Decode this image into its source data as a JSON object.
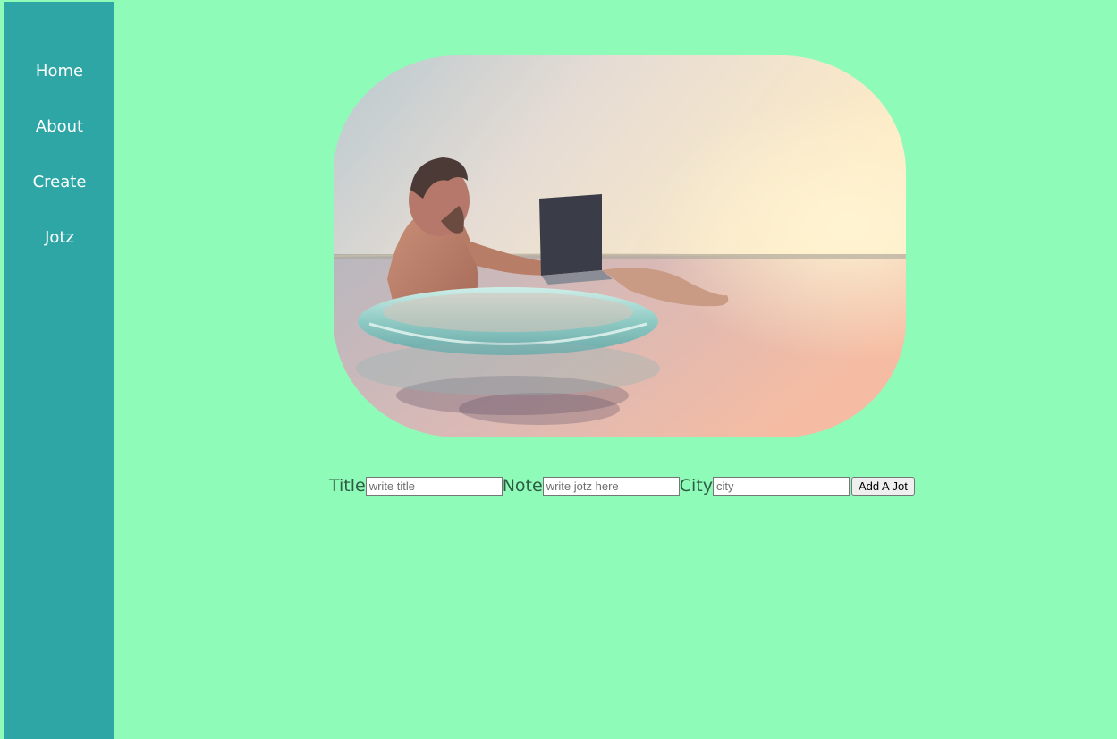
{
  "nav": {
    "items": [
      {
        "label": "Home"
      },
      {
        "label": "About"
      },
      {
        "label": "Create"
      },
      {
        "label": "Jotz"
      }
    ]
  },
  "form": {
    "title_label": "Title",
    "title_placeholder": "write title",
    "note_label": "Note",
    "note_placeholder": "write jotz here",
    "city_label": "City",
    "city_placeholder": "city",
    "submit_label": "Add A Jot"
  },
  "colors": {
    "page_background": "#8efbb9",
    "sidebar_background": "#2fa6a6",
    "nav_text": "#ffffff",
    "label_text": "#2f5b45"
  },
  "hero_image": {
    "icon": "person-on-inflatable-ring-with-laptop-photo"
  }
}
